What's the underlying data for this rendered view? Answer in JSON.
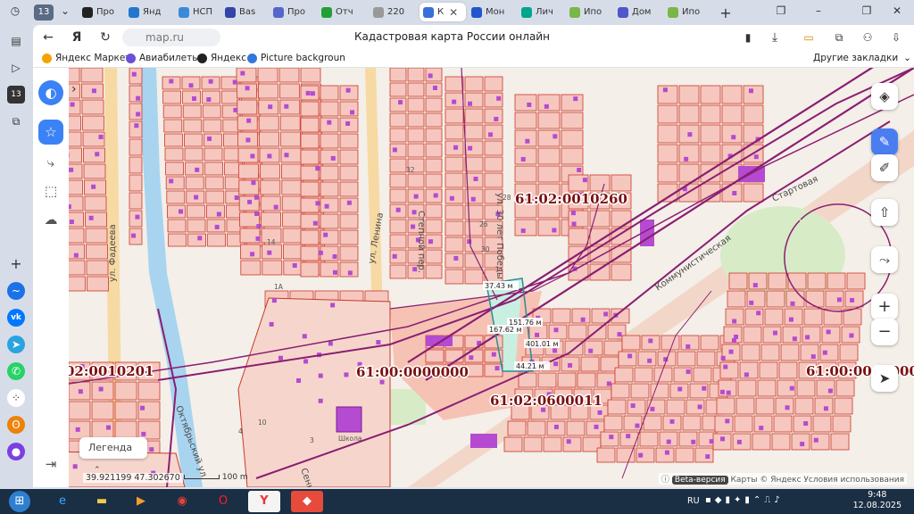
{
  "browser": {
    "tab_count": "13",
    "tabs": [
      {
        "label": "Про",
        "color": "#222222"
      },
      {
        "label": "Янд",
        "color": "#2277cc"
      },
      {
        "label": "НСП",
        "color": "#3b8ad9"
      },
      {
        "label": "Вas",
        "color": "#3344aa"
      },
      {
        "label": "Про",
        "color": "#5566cc"
      },
      {
        "label": "Отч",
        "color": "#21a038"
      },
      {
        "label": "220",
        "color": "#999999"
      },
      {
        "label": "К",
        "color": "#3a6fd8"
      },
      {
        "label": "Мон",
        "color": "#2255cc"
      },
      {
        "label": "Лич",
        "color": "#00a58e"
      },
      {
        "label": "Ипо",
        "color": "#7ab648"
      },
      {
        "label": "Дом",
        "color": "#5055c8"
      },
      {
        "label": "Ипо",
        "color": "#7ab648"
      }
    ],
    "url": "map.ru",
    "page_title": "Кадастровая карта России онлайн",
    "bookmarks": [
      {
        "label": "Яндекс Маркет",
        "color": "#f4a300"
      },
      {
        "label": "Авиабилеты",
        "color": "#6b4fd8"
      },
      {
        "label": "Яндекс",
        "color": "#222222"
      },
      {
        "label": "Picture backgroun",
        "color": "#3377dd"
      }
    ],
    "other_bookmarks": "Другие закладки"
  },
  "map": {
    "cadastral_labels": [
      "61:02:0010260",
      "02:0010201",
      "61:00:0000000",
      "61:02:0600011",
      "61:00:0000000"
    ],
    "streets": [
      "ул. Фадеева",
      "ул. Ленина",
      "Степной пер.",
      "ул. 30 лет Победы",
      "Октябрьский ул.",
      "Сенная пер.",
      "Стартовая",
      "Коммунистическая"
    ],
    "measurements": [
      "37.43 м",
      "151.76 м",
      "167.62 м",
      "401.01 м",
      "44.21 м"
    ],
    "house_numbers": [
      "99",
      "87",
      "14",
      "1А",
      "32",
      "30",
      "26",
      "28",
      "10",
      "3",
      "4"
    ],
    "school_label": "Школа",
    "colors": {
      "parcel_fill": "#f6c7bf",
      "parcel_stroke": "#c9392a",
      "building": "#b44bd0",
      "boundary": "#8a1e72",
      "river": "#a8d4f0",
      "green": "#d7ebc7",
      "road": "#f7d9a3",
      "highlight": "#c8efe0"
    }
  },
  "legend_label": "Легенда",
  "coords": "39.921199  47.302670",
  "scale_label": "100 m",
  "copyright": {
    "beta": "Beta-версия",
    "maps": "Карты © Яндекс",
    "terms": "Условия использования"
  },
  "taskbar": {
    "lang": "RU",
    "time": "9:48",
    "date": "12.08.2025"
  }
}
